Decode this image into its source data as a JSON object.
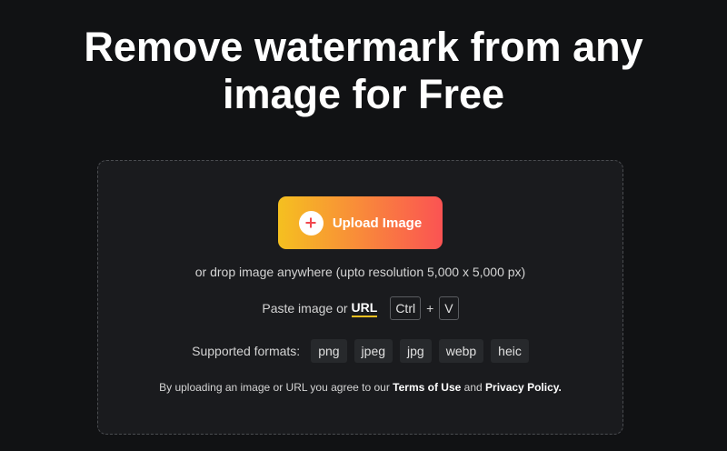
{
  "hero": {
    "title_line1": "Remove watermark from any",
    "title_line2": "image for Free"
  },
  "upload": {
    "button_label": "Upload Image",
    "icon": "plus-icon",
    "drop_hint": "or drop image anywhere (upto resolution 5,000 x 5,000 px)"
  },
  "paste": {
    "prefix": "Paste image or",
    "url_label": "URL",
    "key_ctrl": "Ctrl",
    "plus": "+",
    "key_v": "V"
  },
  "formats": {
    "label": "Supported formats:",
    "items": [
      "png",
      "jpeg",
      "jpg",
      "webp",
      "heic"
    ]
  },
  "terms": {
    "prefix": "By uploading an image or URL you agree to our",
    "terms_label": "Terms of Use",
    "and": "and",
    "privacy_label": "Privacy Policy."
  },
  "colors": {
    "background": "#111214",
    "panel": "#1a1b1e",
    "gradient_start": "#f5c020",
    "gradient_end": "#fa5353",
    "accent_underline": "#f5c020"
  }
}
